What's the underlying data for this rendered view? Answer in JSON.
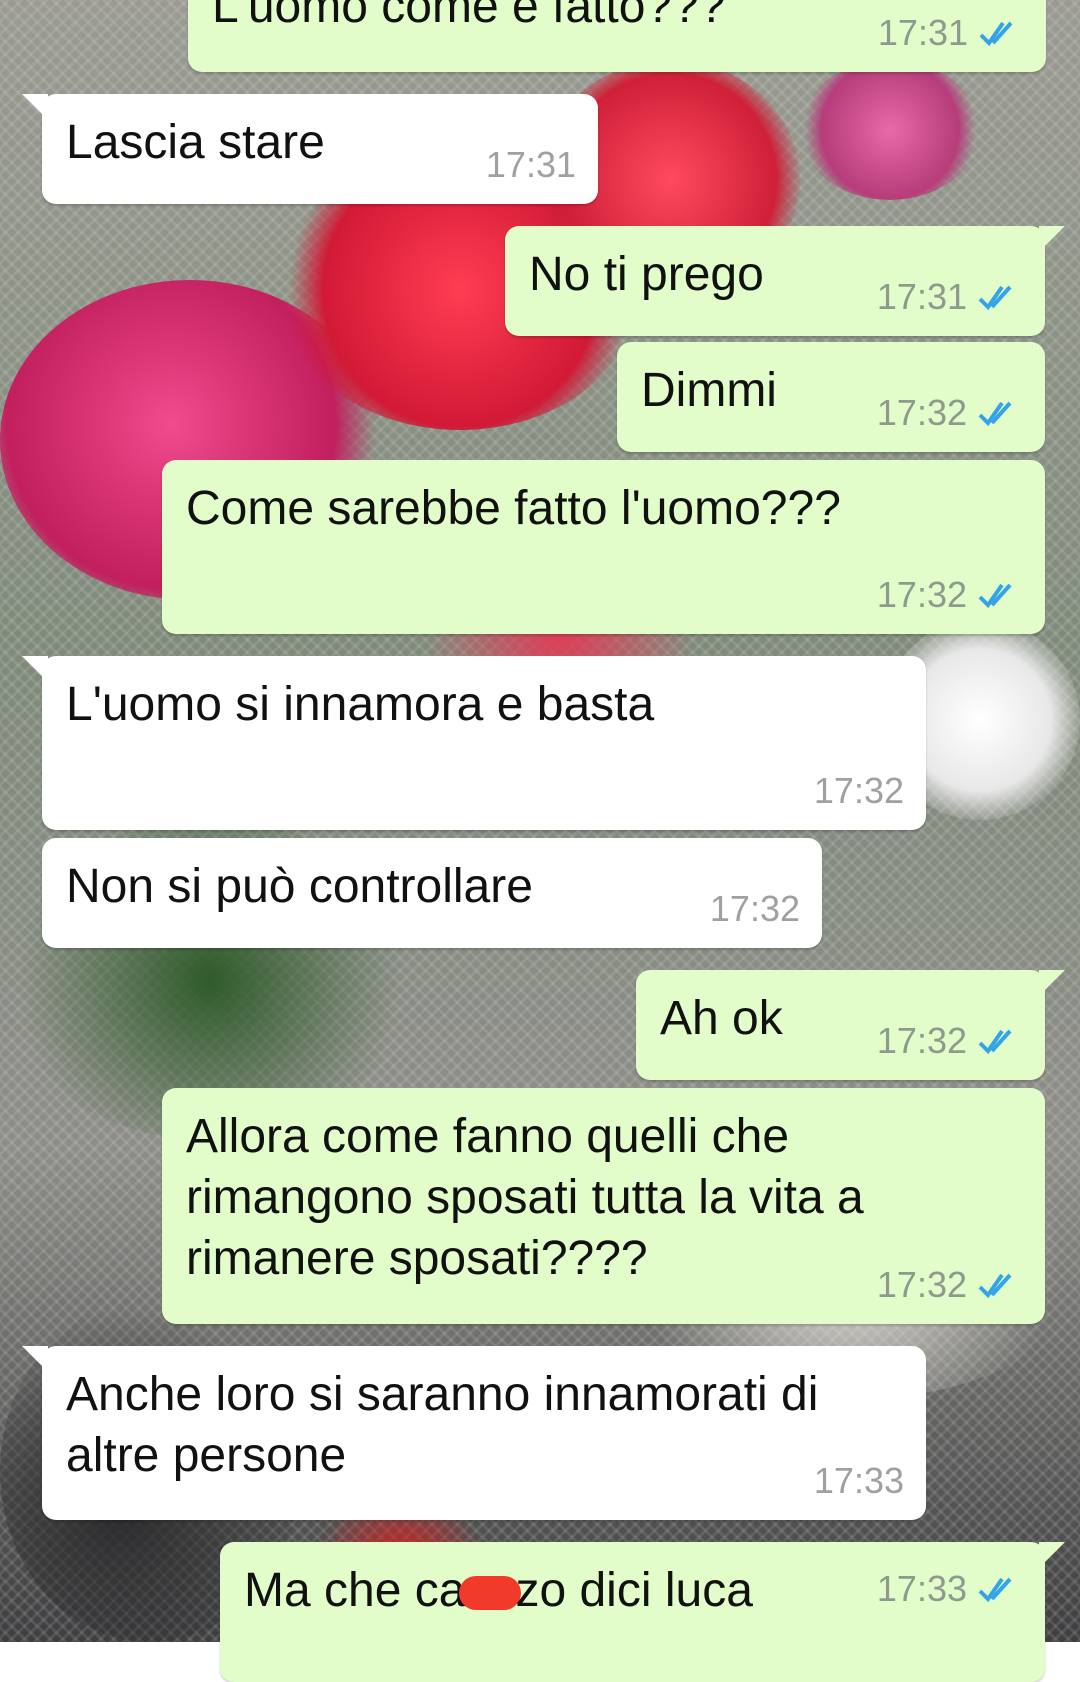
{
  "messages": [
    {
      "id": "m0",
      "direction": "out",
      "text": "L'uomo come è fatto???",
      "time": "17:31",
      "status": "read"
    },
    {
      "id": "m1",
      "direction": "in",
      "text": "Lascia stare",
      "time": "17:31"
    },
    {
      "id": "m2",
      "direction": "out",
      "text": "No ti prego",
      "time": "17:31",
      "status": "read"
    },
    {
      "id": "m3",
      "direction": "out",
      "text": "Dimmi",
      "time": "17:32",
      "status": "read"
    },
    {
      "id": "m4",
      "direction": "out",
      "text": "Come sarebbe fatto l'uomo???",
      "time": "17:32",
      "status": "read"
    },
    {
      "id": "m5",
      "direction": "in",
      "text": "L'uomo si innamora e basta",
      "time": "17:32"
    },
    {
      "id": "m6",
      "direction": "in",
      "text": "Non si può controllare",
      "time": "17:32"
    },
    {
      "id": "m7",
      "direction": "out",
      "text": "Ah ok",
      "time": "17:32",
      "status": "read"
    },
    {
      "id": "m8",
      "direction": "out",
      "text": "Allora come fanno quelli che rimangono sposati tutta la vita a rimanere sposati????",
      "time": "17:32",
      "status": "read"
    },
    {
      "id": "m9",
      "direction": "in",
      "text": "Anche loro si saranno innamorati di altre persone",
      "time": "17:33"
    },
    {
      "id": "m10",
      "direction": "out",
      "text_before": "Ma che ca",
      "text_after": "zo dici luca",
      "time": "17:33",
      "status": "read"
    }
  ],
  "colors": {
    "outgoing_bubble": "#e2fdc9",
    "incoming_bubble": "#ffffff",
    "read_tick": "#34a4e8",
    "redaction": "#f23a2a"
  },
  "icons": {
    "read_receipt": "double-check-icon"
  }
}
